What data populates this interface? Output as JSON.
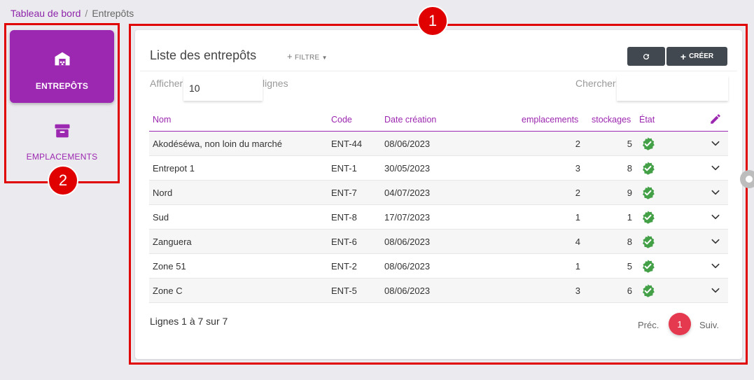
{
  "breadcrumb": {
    "home": "Tableau de bord",
    "separator": "/",
    "current": "Entrepôts"
  },
  "sidebar": {
    "items": [
      {
        "label": "ENTREPÔTS",
        "icon": "warehouse-icon",
        "active": true
      },
      {
        "label": "EMPLACEMENTS",
        "icon": "archive-box-icon",
        "active": false
      }
    ]
  },
  "annotations": {
    "main_badge": "1",
    "sidebar_badge": "2"
  },
  "card": {
    "title": "Liste des entrepôts",
    "filter_label": "FILTRE",
    "create_label": "CRÉER",
    "refresh_icon": "refresh-icon"
  },
  "controls": {
    "show_label": "Afficher",
    "page_size": "10",
    "lines_label": "lignes",
    "search_label": "Chercher:",
    "search_value": ""
  },
  "table": {
    "columns": [
      "Nom",
      "Code",
      "Date création",
      "emplacements",
      "stockages",
      "État"
    ],
    "rows": [
      [
        "Akodéséwa, non loin du marché",
        "ENT-44",
        "08/06/2023",
        "2",
        "5"
      ],
      [
        "Entrepot 1",
        "ENT-1",
        "30/05/2023",
        "3",
        "8"
      ],
      [
        "Nord",
        "ENT-7",
        "04/07/2023",
        "2",
        "9"
      ],
      [
        "Sud",
        "ENT-8",
        "17/07/2023",
        "1",
        "1"
      ],
      [
        "Zanguera",
        "ENT-6",
        "08/06/2023",
        "4",
        "8"
      ],
      [
        "Zone 51",
        "ENT-2",
        "08/06/2023",
        "1",
        "5"
      ],
      [
        "Zone C",
        "ENT-5",
        "08/06/2023",
        "3",
        "6"
      ]
    ]
  },
  "footer": {
    "info": "Lignes 1 à 7 sur 7",
    "prev": "Préc.",
    "page": "1",
    "next": "Suiv."
  },
  "colors": {
    "accent": "#9c27b0",
    "annotation": "#e00000",
    "page_active": "#e53950",
    "ok": "#43a047"
  }
}
